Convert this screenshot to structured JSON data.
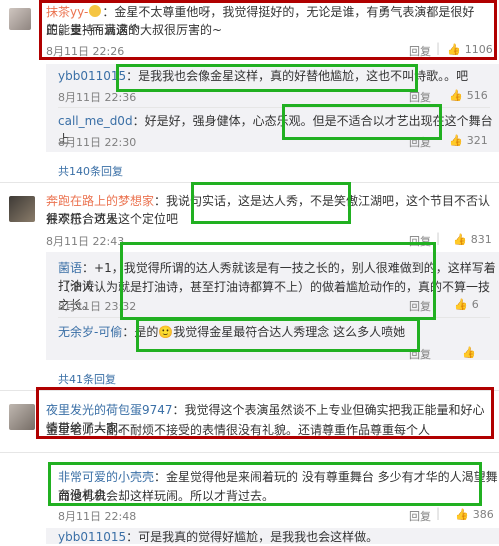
{
  "comments": [
    {
      "user": "抹茶yy-",
      "text_1": "：金星不太尊重他呀，我觉得挺好的，无论是谁，有勇气表演都是很好的，支持~满满的",
      "text_2": "正能量~而且这个大叔很厉害的~",
      "time": "8月11日 22:26",
      "reply_label": "回复",
      "likes": "1106"
    },
    {
      "user": "奔跑在路上的梦想家",
      "text_1": "：我说句实话，这是达人秀，不是笑傲江湖吧，这个节目不否认很欢乐，可是",
      "text_2": "并不符合达人这个定位吧",
      "time": "8月11日 22:43",
      "reply_label": "回复",
      "likes": "831"
    },
    {
      "user": "夜里发光的荷包蛋9747",
      "text_1": "：我觉得这个表演虽然谈不上专业但确实把我正能量和好心情带给了大家。",
      "text_2": "金星老师一副不耐烦不接受的表情很没有礼貌。还请尊重作品尊重每个人",
      "time": "",
      "reply_label": "",
      "likes": ""
    },
    {
      "user": "非常可爱的小壳壳",
      "text_1": "：金星觉得他是来闹着玩的 没有尊重舞台 多少有才华的人渴望舞台没机会",
      "text_2": "而他有机会却这样玩闹。所以才背过去。",
      "time": "8月11日 22:48",
      "reply_label": "回复",
      "likes": "386"
    }
  ],
  "replies_1": [
    {
      "user": "ybb011015",
      "text": "：是我我也会像金星这样，真的好替他尴尬，这也不叫诗歌。。吧",
      "time": "8月11日 22:36",
      "likes": "516"
    },
    {
      "user": "call_me_d0d",
      "text": "：好是好，强身健体，心态乐观。但是不适合以才艺出现在这个舞台上",
      "time": "8月11日 22:30",
      "likes": "321"
    }
  ],
  "replies_2": [
    {
      "user": "菌语",
      "text_1": "：+1，我觉得所谓的达人秀就该是有一技之长的，别人很难做到的，这样写着打油诗",
      "text_2": "（个人认为就是打油诗，甚至打油诗都算不上）的做着尴尬动作的，真的不算一技之长。",
      "time": "8月11日 23:32",
      "likes": "6"
    },
    {
      "user": "无余岁-可偷",
      "text": "：是的🙂我觉得金星最符合达人秀理念 这么多人喷她",
      "time": "",
      "likes": ""
    }
  ],
  "replies_4": [
    {
      "user": "ybb011015",
      "text": "：可是我真的觉得好尴尬，是我我也会这样做。"
    }
  ],
  "more_1": "共140条回复",
  "more_2": "共41条回复",
  "reply_label": "回复",
  "colors": {
    "name": "#eb7350",
    "reply_name": "#3a6fa6",
    "red_box": "#b00000",
    "green_box": "#21b021"
  },
  "icons": [
    "heart-emoji-icon",
    "thumb-up-icon",
    "avatar"
  ]
}
